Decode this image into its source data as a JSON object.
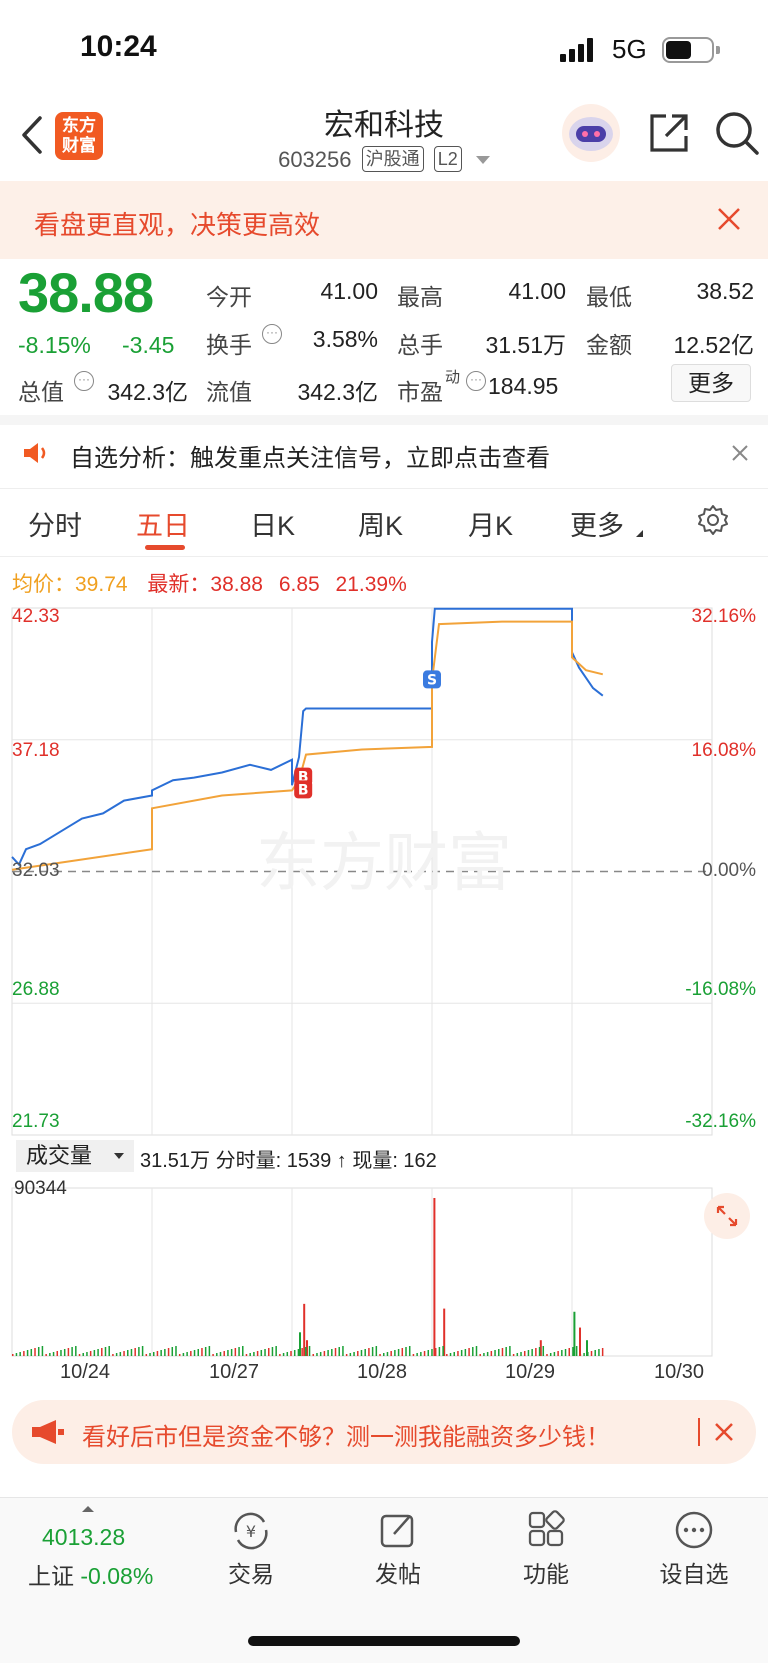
{
  "status": {
    "time": "10:24",
    "network": "5G",
    "battery_level": 0.6
  },
  "header": {
    "logo_line1": "东方",
    "logo_line2": "财富",
    "stock_name": "宏和科技",
    "stock_code": "603256",
    "tag_connect": "沪股通",
    "tag_level": "L2"
  },
  "banner": {
    "text": "看盘更直观，决策更高效"
  },
  "quote": {
    "price": "38.88",
    "change_pct": "-8.15%",
    "change": "-3.45",
    "open_label": "今开",
    "open": "41.00",
    "high_label": "最高",
    "high": "41.00",
    "low_label": "最低",
    "low": "38.52",
    "turnover_label": "换手",
    "turnover": "3.58%",
    "volume_label": "总手",
    "volume": "31.51万",
    "amount_label": "金额",
    "amount": "12.52亿",
    "mktcap_label": "总值",
    "mktcap": "342.3亿",
    "float_label": "流值",
    "float_cap": "342.3亿",
    "pe_label": "市盈",
    "pe_sup": "动",
    "pe": "184.95",
    "more_label": "更多"
  },
  "notice": {
    "text": "自选分析：触发重点关注信号，立即点击查看"
  },
  "tabs": [
    "分时",
    "五日",
    "日K",
    "周K",
    "月K",
    "更多"
  ],
  "active_tab": "五日",
  "chart_info": {
    "avg_label": "均价：",
    "avg": "39.74",
    "latest_label": "最新：",
    "latest": "38.88",
    "diff": "6.85",
    "diff_pct": "21.39%"
  },
  "chart_data": {
    "type": "line",
    "title": "",
    "y_left_ticks": [
      "42.33",
      "37.18",
      "32.03",
      "26.88",
      "21.73"
    ],
    "y_right_ticks": [
      "32.16%",
      "16.08%",
      "0.00%",
      "-16.08%",
      "-32.16%"
    ],
    "x_labels": [
      "10/24",
      "10/27",
      "10/28",
      "10/29",
      "10/30"
    ],
    "ylim": [
      21.73,
      42.33
    ],
    "base_price": 32.03,
    "series": [
      {
        "values": [
          [
            0.0,
            32.6
          ],
          [
            0.05,
            32.3
          ],
          [
            0.1,
            32.9
          ],
          [
            0.2,
            33.1
          ],
          [
            0.35,
            33.6
          ],
          [
            0.5,
            34.1
          ],
          [
            0.65,
            34.3
          ],
          [
            0.8,
            34.8
          ],
          [
            1.0,
            35.0
          ],
          [
            1.0,
            35.2
          ],
          [
            1.15,
            35.6
          ],
          [
            1.3,
            35.7
          ],
          [
            1.5,
            35.9
          ],
          [
            1.7,
            36.2
          ],
          [
            1.85,
            36.0
          ],
          [
            2.0,
            36.4
          ],
          [
            2.0,
            35.4
          ],
          [
            2.05,
            36.5
          ],
          [
            2.08,
            38.3
          ],
          [
            2.1,
            38.4
          ],
          [
            2.2,
            38.4
          ],
          [
            2.6,
            38.4
          ],
          [
            3.0,
            38.4
          ],
          [
            3.0,
            41.0
          ],
          [
            3.02,
            42.3
          ],
          [
            3.05,
            42.3
          ],
          [
            3.5,
            42.3
          ],
          [
            4.0,
            42.3
          ],
          [
            4.0,
            40.6
          ],
          [
            4.05,
            40.0
          ],
          [
            4.1,
            39.6
          ],
          [
            4.15,
            39.2
          ],
          [
            4.22,
            38.9
          ]
        ]
      },
      {
        "values": [
          [
            0.0,
            32.1
          ],
          [
            0.5,
            32.5
          ],
          [
            1.0,
            32.9
          ],
          [
            1.0,
            34.5
          ],
          [
            1.5,
            35.0
          ],
          [
            2.0,
            35.2
          ],
          [
            2.05,
            35.6
          ],
          [
            2.1,
            36.6
          ],
          [
            2.5,
            36.8
          ],
          [
            3.0,
            36.9
          ],
          [
            3.0,
            39.5
          ],
          [
            3.05,
            41.7
          ],
          [
            3.5,
            41.8
          ],
          [
            4.0,
            41.8
          ],
          [
            4.0,
            40.4
          ],
          [
            4.1,
            39.9
          ],
          [
            4.22,
            39.74
          ]
        ]
      }
    ],
    "markers": [
      "B",
      "B",
      "S"
    ],
    "volume_label": "成交量",
    "volume_info": "31.51万 分时量: 1539 ↑ 现量: 162",
    "volume_current": "162",
    "volume_max": "90344"
  },
  "ad": {
    "text": "看好后市但是资金不够？测一测我能融资多少钱！"
  },
  "nav": {
    "index_value": "4013.28",
    "index_name": "上证",
    "index_change": "-0.08%",
    "trade": "交易",
    "post": "发帖",
    "features": "功能",
    "watchlist": "设自选",
    "currency_glyph": "¥"
  }
}
